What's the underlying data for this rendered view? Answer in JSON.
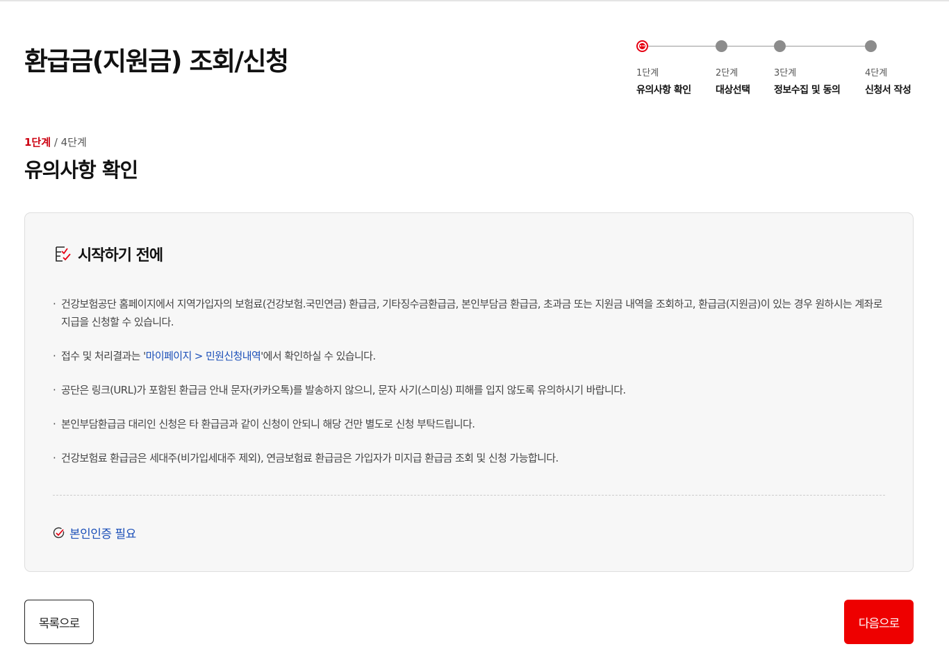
{
  "page": {
    "title": "환급금(지원금) 조회/신청"
  },
  "stepper": {
    "steps": [
      {
        "num": "1단계",
        "name": "유의사항 확인",
        "state": "active"
      },
      {
        "num": "2단계",
        "name": "대상선택",
        "state": "inactive"
      },
      {
        "num": "3단계",
        "name": "정보수집 및 동의",
        "state": "inactive"
      },
      {
        "num": "4단계",
        "name": "신청서 작성",
        "state": "inactive"
      }
    ]
  },
  "progress": {
    "current": "1단계",
    "separator": " / ",
    "total": "4단계"
  },
  "section": {
    "title": "유의사항 확인"
  },
  "notice": {
    "title": "시작하기 전에",
    "items": [
      {
        "text": "건강보험공단 홈페이지에서 지역가입자의 보험료(건강보험.국민연금) 환급금, 기타징수금환급금, 본인부담금 환급금, 초과금 또는 지원금 내역을 조회하고, 환급금(지원금)이 있는 경우 원하시는 계좌로 지급을 신청할 수 있습니다."
      },
      {
        "text_before": "접수 및 처리결과는 '",
        "link": "마이페이지 > 민원신청내역",
        "text_after": "'에서 확인하실 수 있습니다."
      },
      {
        "text": "공단은 링크(URL)가 포함된 환급금 안내 문자(카카오톡)를 발송하지 않으니, 문자 사기(스미싱) 피해를 입지 않도록 유의하시기 바랍니다."
      },
      {
        "text": "본인부담환급금 대리인 신청은 타 환급금과 같이 신청이 안되니 해당 건만 별도로 신청 부탁드립니다."
      },
      {
        "text": "건강보험료 환급금은 세대주(비가입세대주 제외), 연금보험료 환급금은 가입자가 미지급 환급금 조회 및 신청 가능합니다."
      }
    ],
    "auth_label": "본인인증 필요"
  },
  "buttons": {
    "list_label": "목록으로",
    "next_label": "다음으로"
  },
  "colors": {
    "accent": "#ee0000",
    "step_red": "#cc0010",
    "link_blue": "#1b4fb8",
    "box_bg": "#f7f7f7"
  },
  "icons": {
    "active_step": "ellipsis-circle-icon",
    "notice_header": "checklist-icon",
    "auth": "check-circle-icon"
  }
}
